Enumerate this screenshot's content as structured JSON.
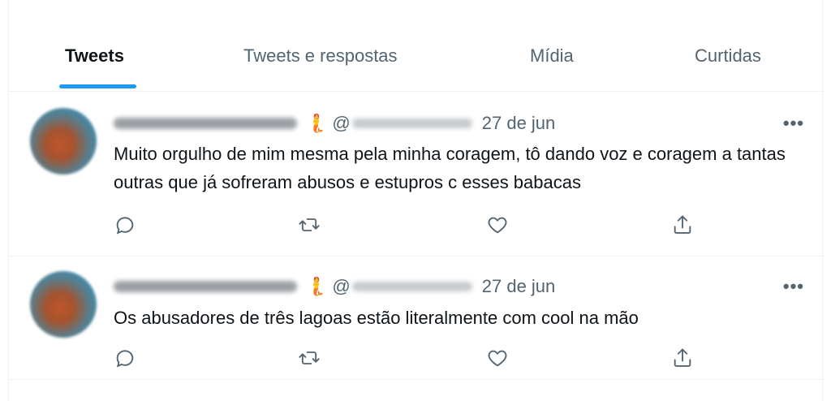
{
  "tabs": [
    {
      "label": "Tweets",
      "active": true
    },
    {
      "label": "Tweets e respostas",
      "active": false
    },
    {
      "label": "Mídia",
      "active": false
    },
    {
      "label": "Curtidas",
      "active": false
    }
  ],
  "colors": {
    "accent": "#1d9bf0",
    "secondary_text": "#536471",
    "primary_text": "#0f1419",
    "divider": "#eff3f4"
  },
  "tweets": [
    {
      "name_emoji": "🧜",
      "handle_prefix": "@",
      "date": "27 de jun",
      "more_label": "•••",
      "text": "Muito orgulho de mim mesma pela minha coragem, tô dando voz e coragem a tantas outras que já sofreram abusos e estupros c esses babacas",
      "actions": [
        "reply-icon",
        "retweet-icon",
        "like-icon",
        "share-icon"
      ]
    },
    {
      "name_emoji": "🧜",
      "handle_prefix": "@",
      "date": "27 de jun",
      "more_label": "•••",
      "text": "Os abusadores de três lagoas estão literalmente com cool na mão",
      "actions": [
        "reply-icon",
        "retweet-icon",
        "like-icon",
        "share-icon"
      ]
    }
  ]
}
